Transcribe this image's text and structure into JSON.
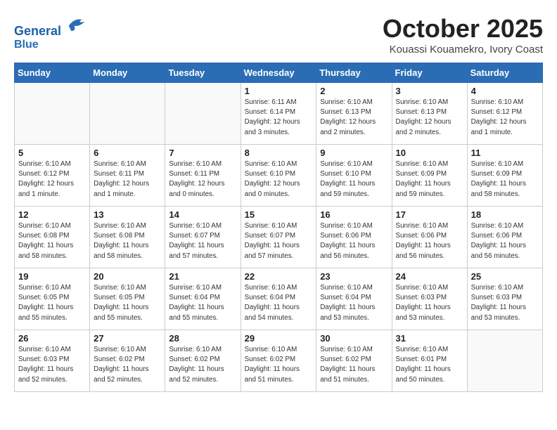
{
  "header": {
    "logo_line1": "General",
    "logo_line2": "Blue",
    "month": "October 2025",
    "location": "Kouassi Kouamekro, Ivory Coast"
  },
  "weekdays": [
    "Sunday",
    "Monday",
    "Tuesday",
    "Wednesday",
    "Thursday",
    "Friday",
    "Saturday"
  ],
  "weeks": [
    [
      {
        "day": "",
        "info": ""
      },
      {
        "day": "",
        "info": ""
      },
      {
        "day": "",
        "info": ""
      },
      {
        "day": "1",
        "info": "Sunrise: 6:11 AM\nSunset: 6:14 PM\nDaylight: 12 hours and 3 minutes."
      },
      {
        "day": "2",
        "info": "Sunrise: 6:10 AM\nSunset: 6:13 PM\nDaylight: 12 hours and 2 minutes."
      },
      {
        "day": "3",
        "info": "Sunrise: 6:10 AM\nSunset: 6:13 PM\nDaylight: 12 hours and 2 minutes."
      },
      {
        "day": "4",
        "info": "Sunrise: 6:10 AM\nSunset: 6:12 PM\nDaylight: 12 hours and 1 minute."
      }
    ],
    [
      {
        "day": "5",
        "info": "Sunrise: 6:10 AM\nSunset: 6:12 PM\nDaylight: 12 hours and 1 minute."
      },
      {
        "day": "6",
        "info": "Sunrise: 6:10 AM\nSunset: 6:11 PM\nDaylight: 12 hours and 1 minute."
      },
      {
        "day": "7",
        "info": "Sunrise: 6:10 AM\nSunset: 6:11 PM\nDaylight: 12 hours and 0 minutes."
      },
      {
        "day": "8",
        "info": "Sunrise: 6:10 AM\nSunset: 6:10 PM\nDaylight: 12 hours and 0 minutes."
      },
      {
        "day": "9",
        "info": "Sunrise: 6:10 AM\nSunset: 6:10 PM\nDaylight: 11 hours and 59 minutes."
      },
      {
        "day": "10",
        "info": "Sunrise: 6:10 AM\nSunset: 6:09 PM\nDaylight: 11 hours and 59 minutes."
      },
      {
        "day": "11",
        "info": "Sunrise: 6:10 AM\nSunset: 6:09 PM\nDaylight: 11 hours and 58 minutes."
      }
    ],
    [
      {
        "day": "12",
        "info": "Sunrise: 6:10 AM\nSunset: 6:08 PM\nDaylight: 11 hours and 58 minutes."
      },
      {
        "day": "13",
        "info": "Sunrise: 6:10 AM\nSunset: 6:08 PM\nDaylight: 11 hours and 58 minutes."
      },
      {
        "day": "14",
        "info": "Sunrise: 6:10 AM\nSunset: 6:07 PM\nDaylight: 11 hours and 57 minutes."
      },
      {
        "day": "15",
        "info": "Sunrise: 6:10 AM\nSunset: 6:07 PM\nDaylight: 11 hours and 57 minutes."
      },
      {
        "day": "16",
        "info": "Sunrise: 6:10 AM\nSunset: 6:06 PM\nDaylight: 11 hours and 56 minutes."
      },
      {
        "day": "17",
        "info": "Sunrise: 6:10 AM\nSunset: 6:06 PM\nDaylight: 11 hours and 56 minutes."
      },
      {
        "day": "18",
        "info": "Sunrise: 6:10 AM\nSunset: 6:06 PM\nDaylight: 11 hours and 56 minutes."
      }
    ],
    [
      {
        "day": "19",
        "info": "Sunrise: 6:10 AM\nSunset: 6:05 PM\nDaylight: 11 hours and 55 minutes."
      },
      {
        "day": "20",
        "info": "Sunrise: 6:10 AM\nSunset: 6:05 PM\nDaylight: 11 hours and 55 minutes."
      },
      {
        "day": "21",
        "info": "Sunrise: 6:10 AM\nSunset: 6:04 PM\nDaylight: 11 hours and 55 minutes."
      },
      {
        "day": "22",
        "info": "Sunrise: 6:10 AM\nSunset: 6:04 PM\nDaylight: 11 hours and 54 minutes."
      },
      {
        "day": "23",
        "info": "Sunrise: 6:10 AM\nSunset: 6:04 PM\nDaylight: 11 hours and 53 minutes."
      },
      {
        "day": "24",
        "info": "Sunrise: 6:10 AM\nSunset: 6:03 PM\nDaylight: 11 hours and 53 minutes."
      },
      {
        "day": "25",
        "info": "Sunrise: 6:10 AM\nSunset: 6:03 PM\nDaylight: 11 hours and 53 minutes."
      }
    ],
    [
      {
        "day": "26",
        "info": "Sunrise: 6:10 AM\nSunset: 6:03 PM\nDaylight: 11 hours and 52 minutes."
      },
      {
        "day": "27",
        "info": "Sunrise: 6:10 AM\nSunset: 6:02 PM\nDaylight: 11 hours and 52 minutes."
      },
      {
        "day": "28",
        "info": "Sunrise: 6:10 AM\nSunset: 6:02 PM\nDaylight: 11 hours and 52 minutes."
      },
      {
        "day": "29",
        "info": "Sunrise: 6:10 AM\nSunset: 6:02 PM\nDaylight: 11 hours and 51 minutes."
      },
      {
        "day": "30",
        "info": "Sunrise: 6:10 AM\nSunset: 6:02 PM\nDaylight: 11 hours and 51 minutes."
      },
      {
        "day": "31",
        "info": "Sunrise: 6:10 AM\nSunset: 6:01 PM\nDaylight: 11 hours and 50 minutes."
      },
      {
        "day": "",
        "info": ""
      }
    ]
  ]
}
